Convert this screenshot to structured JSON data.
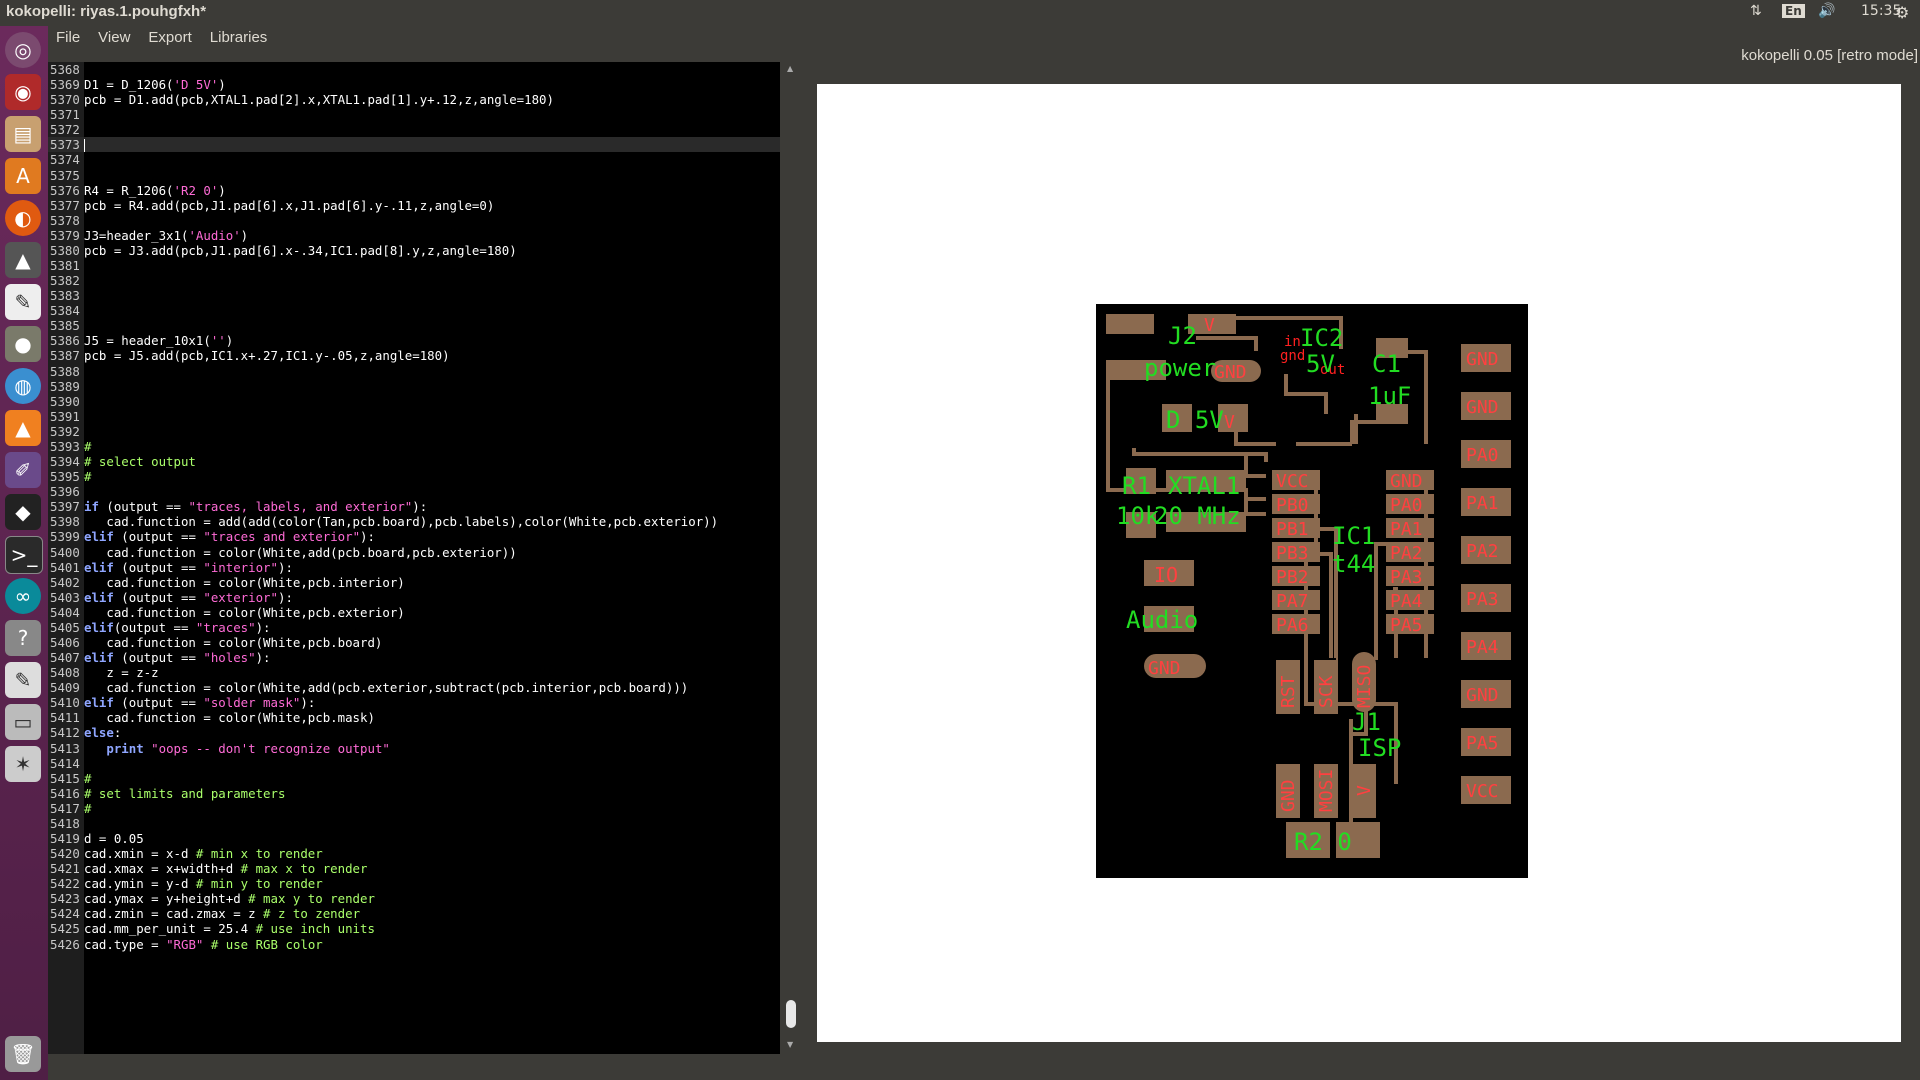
{
  "window": {
    "title": "kokopelli:  riyas.1.pouhgfxh*"
  },
  "indicators": {
    "keyboard": "En",
    "clock": "15:35"
  },
  "menu": [
    "File",
    "View",
    "Export",
    "Libraries"
  ],
  "app_title": "kokopelli 0.05 [retro mode]",
  "launcher_icons": [
    "ubuntu-icon",
    "network-icon",
    "files-icon",
    "software-center-icon",
    "firefox-icon",
    "inkscape-icon",
    "draw-icon",
    "gimp-icon",
    "chromium-icon",
    "vlc-icon",
    "pen-tool-icon",
    "flash-icon",
    "terminal-icon",
    "arduino-icon",
    "help-icon",
    "text-editor-icon",
    "drive-icon",
    "kokopelli-icon",
    "trash-icon"
  ],
  "code_lines": [
    {
      "n": "5368",
      "t": ""
    },
    {
      "n": "5369",
      "t": "D1 = D_1206('D 5V')"
    },
    {
      "n": "5370",
      "t": "pcb = D1.add(pcb,XTAL1.pad[2].x,XTAL1.pad[1].y+.12,z,angle=180)"
    },
    {
      "n": "5371",
      "t": ""
    },
    {
      "n": "5372",
      "t": ""
    },
    {
      "n": "5373",
      "t": "",
      "cursor": true
    },
    {
      "n": "5374",
      "t": ""
    },
    {
      "n": "5375",
      "t": ""
    },
    {
      "n": "5376",
      "t": "R4 = R_1206('R2 0')"
    },
    {
      "n": "5377",
      "t": "pcb = R4.add(pcb,J1.pad[6].x,J1.pad[6].y-.11,z,angle=0)"
    },
    {
      "n": "5378",
      "t": ""
    },
    {
      "n": "5379",
      "t": "J3=header_3x1('Audio')"
    },
    {
      "n": "5380",
      "t": "pcb = J3.add(pcb,J1.pad[6].x-.34,IC1.pad[8].y,z,angle=180)"
    },
    {
      "n": "5381",
      "t": ""
    },
    {
      "n": "5382",
      "t": ""
    },
    {
      "n": "5383",
      "t": ""
    },
    {
      "n": "5384",
      "t": ""
    },
    {
      "n": "5385",
      "t": ""
    },
    {
      "n": "5386",
      "t": "J5 = header_10x1('')"
    },
    {
      "n": "5387",
      "t": "pcb = J5.add(pcb,IC1.x+.27,IC1.y-.05,z,angle=180)"
    },
    {
      "n": "5388",
      "t": ""
    },
    {
      "n": "5389",
      "t": ""
    },
    {
      "n": "5390",
      "t": ""
    },
    {
      "n": "5391",
      "t": ""
    },
    {
      "n": "5392",
      "t": ""
    },
    {
      "n": "5393",
      "t": "#"
    },
    {
      "n": "5394",
      "t": "# select output"
    },
    {
      "n": "5395",
      "t": "#"
    },
    {
      "n": "5396",
      "t": ""
    },
    {
      "n": "5397",
      "t": "if (output == \"traces, labels, and exterior\"):"
    },
    {
      "n": "5398",
      "t": "   cad.function = add(add(color(Tan,pcb.board),pcb.labels),color(White,pcb.exterior))"
    },
    {
      "n": "5399",
      "t": "elif (output == \"traces and exterior\"):"
    },
    {
      "n": "5400",
      "t": "   cad.function = color(White,add(pcb.board,pcb.exterior))"
    },
    {
      "n": "5401",
      "t": "elif (output == \"interior\"):"
    },
    {
      "n": "5402",
      "t": "   cad.function = color(White,pcb.interior)"
    },
    {
      "n": "5403",
      "t": "elif (output == \"exterior\"):"
    },
    {
      "n": "5404",
      "t": "   cad.function = color(White,pcb.exterior)"
    },
    {
      "n": "5405",
      "t": "elif(output == \"traces\"):"
    },
    {
      "n": "5406",
      "t": "   cad.function = color(White,pcb.board)"
    },
    {
      "n": "5407",
      "t": "elif (output == \"holes\"):"
    },
    {
      "n": "5408",
      "t": "   z = z-z"
    },
    {
      "n": "5409",
      "t": "   cad.function = color(White,add(pcb.exterior,subtract(pcb.interior,pcb.board)))"
    },
    {
      "n": "5410",
      "t": "elif (output == \"solder mask\"):"
    },
    {
      "n": "5411",
      "t": "   cad.function = color(White,pcb.mask)"
    },
    {
      "n": "5412",
      "t": "else:"
    },
    {
      "n": "5413",
      "t": "   print \"oops -- don't recognize output\""
    },
    {
      "n": "5414",
      "t": ""
    },
    {
      "n": "5415",
      "t": "#"
    },
    {
      "n": "5416",
      "t": "# set limits and parameters"
    },
    {
      "n": "5417",
      "t": "#"
    },
    {
      "n": "5418",
      "t": ""
    },
    {
      "n": "5419",
      "t": "d = 0.05"
    },
    {
      "n": "5420",
      "t": "cad.xmin = x-d # min x to render"
    },
    {
      "n": "5421",
      "t": "cad.xmax = x+width+d # max x to render"
    },
    {
      "n": "5422",
      "t": "cad.ymin = y-d # min y to render"
    },
    {
      "n": "5423",
      "t": "cad.ymax = y+height+d # max y to render"
    },
    {
      "n": "5424",
      "t": "cad.zmin = cad.zmax = z # z to zender"
    },
    {
      "n": "5425",
      "t": "cad.mm_per_unit = 25.4 # use inch units"
    },
    {
      "n": "5426",
      "t": "cad.type = \"RGB\" # use RGB color"
    }
  ],
  "pcb_labels": {
    "j2": "J2",
    "power": "power",
    "v_top": "V",
    "gnd_j2": "GND",
    "ic2": "IC2",
    "ic2_5v": "5V",
    "ic2_in": "in",
    "gnd_small": "gnd",
    "out": "out",
    "c1": "C1",
    "c1_val": "1uF",
    "d5v": "D 5V",
    "r1": "R1",
    "r1_val": "10k",
    "xtal1": "XTAL1",
    "xtal_val": "20 MHz",
    "ic1": "IC1",
    "ic1_val": "t44",
    "io": "IO",
    "audio": "Audio",
    "gnd_audio": "GND",
    "vcc": "VCC",
    "pb0": "PB0",
    "pb1": "PB1",
    "pb3": "PB3",
    "pb2": "PB2",
    "pa7": "PA7",
    "pa6": "PA6",
    "gnd_ic": "GND",
    "pa0_ic": "PA0",
    "pa1_ic": "PA1",
    "pa2_ic": "PA2",
    "pa3_ic": "PA3",
    "pa4_ic": "PA4",
    "pa5_ic": "PA5",
    "rst": "RST",
    "sck": "SCK",
    "miso": "MISO",
    "mosi": "MOSI",
    "gnd_isp": "GND",
    "v_isp": "V",
    "j1": "J1",
    "isp": "ISP",
    "r2": "R2 0",
    "h_gnd1": "GND",
    "h_gnd2": "GND",
    "h_pa0": "PA0",
    "h_pa1": "PA1",
    "h_pa2": "PA2",
    "h_pa3": "PA3",
    "h_pa4": "PA4",
    "h_gnd3": "GND",
    "h_pa5": "PA5",
    "h_vcc": "VCC"
  },
  "colors": {
    "pad": "#8b6a4f",
    "label_green": "#22dd22",
    "label_red": "#ff4040",
    "board": "#000000",
    "canvas": "#ffffff"
  }
}
